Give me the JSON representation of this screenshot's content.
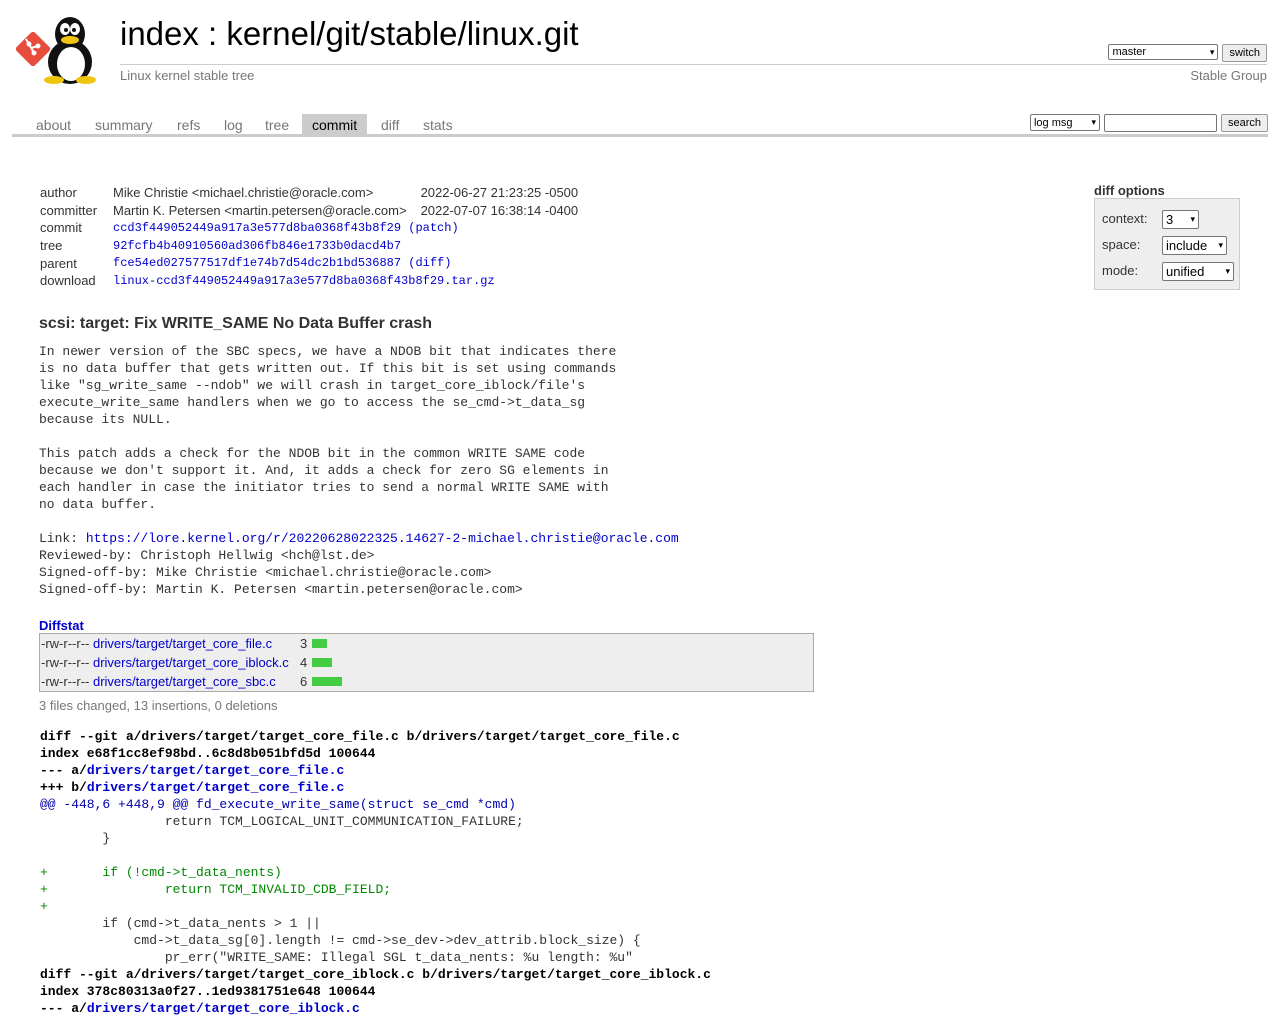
{
  "header": {
    "title_index": "index",
    "title_sep": " : ",
    "title_repo": "kernel/git/stable/linux.git",
    "subtitle": "Linux kernel stable tree",
    "owner": "Stable Group",
    "branch": "master",
    "switch_label": "switch"
  },
  "tabs": [
    "about",
    "summary",
    "refs",
    "log",
    "tree",
    "commit",
    "diff",
    "stats"
  ],
  "active_tab": "commit",
  "search": {
    "scope": "log msg",
    "value": "",
    "button": "search"
  },
  "diff_options": {
    "title": "diff options",
    "context_label": "context:",
    "context_value": "3",
    "space_label": "space:",
    "space_value": "include",
    "mode_label": "mode:",
    "mode_value": "unified"
  },
  "commit": {
    "author_label": "author",
    "author": "Mike Christie <michael.christie@oracle.com>",
    "author_date": "2022-06-27 21:23:25 -0500",
    "committer_label": "committer",
    "committer": "Martin K. Petersen <martin.petersen@oracle.com>",
    "committer_date": "2022-07-07 16:38:14 -0400",
    "commit_label": "commit",
    "commit_sha": "ccd3f449052449a917a3e577d8ba0368f43b8f29",
    "patch_link": "patch",
    "tree_label": "tree",
    "tree_sha": "92fcfb4b40910560ad306fb846e1733b0dacd4b7",
    "parent_label": "parent",
    "parent_sha": "fce54ed027577517df1e74b7d54dc2b1bd536887",
    "diff_link": "diff",
    "download_label": "download",
    "download": "linux-ccd3f449052449a917a3e577d8ba0368f43b8f29.tar.gz",
    "subject": "scsi: target: Fix WRITE_SAME No Data Buffer crash",
    "message_body": "In newer version of the SBC specs, we have a NDOB bit that indicates there\nis no data buffer that gets written out. If this bit is set using commands\nlike \"sg_write_same --ndob\" we will crash in target_core_iblock/file's\nexecute_write_same handlers when we go to access the se_cmd->t_data_sg\nbecause its NULL.\n\nThis patch adds a check for the NDOB bit in the common WRITE SAME code\nbecause we don't support it. And, it adds a check for zero SG elements in\neach handler in case the initiator tries to send a normal WRITE SAME with\nno data buffer.\n\n",
    "link_prefix": "Link: ",
    "link_url": "https://lore.kernel.org/r/20220628022325.14627-2-michael.christie@oracle.com",
    "trailers": "Reviewed-by: Christoph Hellwig <hch@lst.de>\nSigned-off-by: Mike Christie <michael.christie@oracle.com>\nSigned-off-by: Martin K. Petersen <martin.petersen@oracle.com>"
  },
  "diffstat": {
    "title": "Diffstat",
    "files": [
      {
        "mode": "-rw-r--r--",
        "path": "drivers/target/target_core_file.c",
        "changes": 3
      },
      {
        "mode": "-rw-r--r--",
        "path": "drivers/target/target_core_iblock.c",
        "changes": 4
      },
      {
        "mode": "-rw-r--r--",
        "path": "drivers/target/target_core_sbc.c",
        "changes": 6
      }
    ],
    "summary": "3 files changed, 13 insertions, 0 deletions"
  },
  "diff_lines": [
    {
      "type": "head",
      "text": "diff --git a/drivers/target/target_core_file.c b/drivers/target/target_core_file.c"
    },
    {
      "type": "head",
      "text": "index e68f1cc8ef98bd..6c8d8b051bfd5d 100644"
    },
    {
      "type": "head",
      "prefix": "--- a/",
      "link": "drivers/target/target_core_file.c"
    },
    {
      "type": "head",
      "prefix": "+++ b/",
      "link": "drivers/target/target_core_file.c"
    },
    {
      "type": "hunk",
      "text": "@@ -448,6 +448,9 @@ fd_execute_write_same(struct se_cmd *cmd)"
    },
    {
      "type": "ctx",
      "text": " \t\treturn TCM_LOGICAL_UNIT_COMMUNICATION_FAILURE;"
    },
    {
      "type": "ctx",
      "text": " \t}"
    },
    {
      "type": "ctx",
      "text": " "
    },
    {
      "type": "add",
      "text": "+\tif (!cmd->t_data_nents)"
    },
    {
      "type": "add",
      "text": "+\t\treturn TCM_INVALID_CDB_FIELD;"
    },
    {
      "type": "add",
      "text": "+"
    },
    {
      "type": "ctx",
      "text": " \tif (cmd->t_data_nents > 1 ||"
    },
    {
      "type": "ctx",
      "text": " \t    cmd->t_data_sg[0].length != cmd->se_dev->dev_attrib.block_size) {"
    },
    {
      "type": "ctx",
      "text": " \t\tpr_err(\"WRITE_SAME: Illegal SGL t_data_nents: %u length: %u\""
    },
    {
      "type": "head",
      "text": "diff --git a/drivers/target/target_core_iblock.c b/drivers/target/target_core_iblock.c"
    },
    {
      "type": "head",
      "text": "index 378c80313a0f27..1ed9381751e648 100644"
    },
    {
      "type": "head",
      "prefix": "--- a/",
      "link": "drivers/target/target_core_iblock.c"
    }
  ]
}
